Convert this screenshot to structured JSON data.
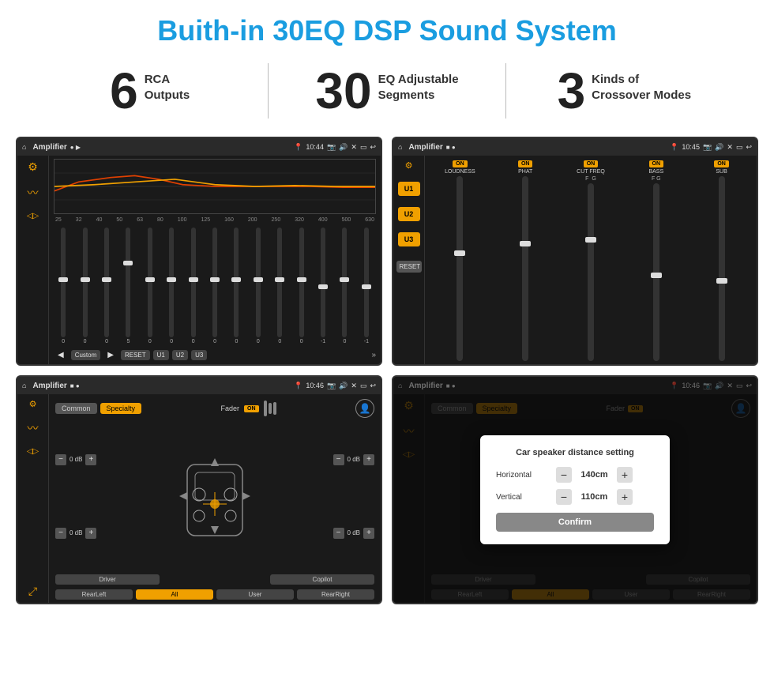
{
  "title": "Buith-in 30EQ DSP Sound System",
  "stats": [
    {
      "number": "6",
      "label": "RCA\nOutputs"
    },
    {
      "number": "30",
      "label": "EQ Adjustable\nSegments"
    },
    {
      "number": "3",
      "label": "Kinds of\nCrossover Modes"
    }
  ],
  "screens": [
    {
      "id": "eq-screen",
      "statusBar": {
        "home": "⌂",
        "title": "Amplifier",
        "icons": "● ▶  📍 10:44  📷  🔊  ✕  ▭  ↩"
      },
      "eq": {
        "freqs": [
          "25",
          "32",
          "40",
          "50",
          "63",
          "80",
          "100",
          "125",
          "160",
          "200",
          "250",
          "320",
          "400",
          "500",
          "630"
        ],
        "values": [
          "0",
          "0",
          "0",
          "5",
          "0",
          "0",
          "0",
          "0",
          "0",
          "0",
          "0",
          "0",
          "-1",
          "0",
          "-1"
        ],
        "presets": [
          "Custom",
          "RESET",
          "U1",
          "U2",
          "U3"
        ]
      }
    },
    {
      "id": "amp-screen",
      "statusBar": {
        "title": "Amplifier",
        "time": "10:45"
      },
      "uButtons": [
        "U1",
        "U2",
        "U3"
      ],
      "controls": [
        {
          "label": "LOUDNESS",
          "on": true
        },
        {
          "label": "PHAT",
          "on": true
        },
        {
          "label": "CUT FREQ",
          "on": true
        },
        {
          "label": "BASS",
          "on": true
        },
        {
          "label": "SUB",
          "on": true
        }
      ]
    },
    {
      "id": "cs-screen",
      "statusBar": {
        "title": "Amplifier",
        "time": "10:46"
      },
      "tabs": [
        "Common",
        "Specialty"
      ],
      "activeTab": "Specialty",
      "faderLabel": "Fader",
      "faderOn": true,
      "bottomButtons": [
        "Driver",
        "",
        "Copilot",
        "RearLeft",
        "All",
        "User",
        "RearRight"
      ],
      "volControls": [
        {
          "label": "0 dB"
        },
        {
          "label": "0 dB"
        },
        {
          "label": "0 dB"
        },
        {
          "label": "0 dB"
        }
      ]
    },
    {
      "id": "dialog-screen",
      "statusBar": {
        "title": "Amplifier",
        "time": "10:46"
      },
      "dialog": {
        "title": "Car speaker distance setting",
        "rows": [
          {
            "label": "Horizontal",
            "value": "140cm"
          },
          {
            "label": "Vertical",
            "value": "110cm"
          }
        ],
        "confirmLabel": "Confirm"
      }
    }
  ],
  "colors": {
    "accent": "#f0a000",
    "title": "#1a9de0",
    "dark": "#1a1a1a"
  }
}
